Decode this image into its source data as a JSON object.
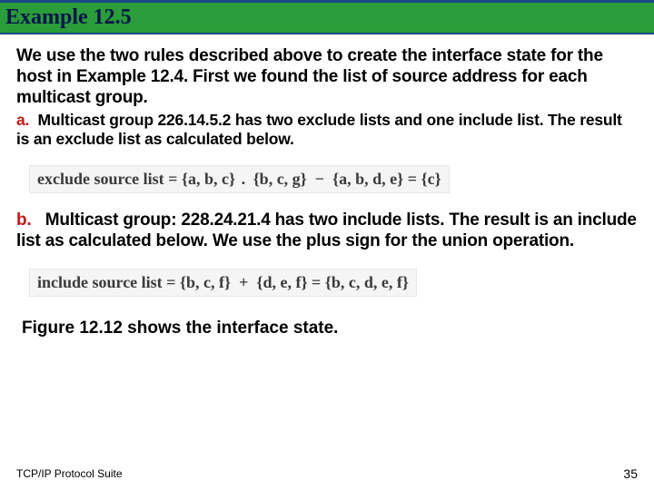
{
  "header": {
    "title": "Example 12.5"
  },
  "body": {
    "intro": "We use the two rules described above to create the interface state for the host in Example 12.4. First we found the list of source address for each multicast group.",
    "a_label": "a.",
    "a_text": "Multicast group 226.14.5.2 has two exclude lists and one include list. The result is an exclude list as calculated below.",
    "formula_a": "exclude source list = {a, b, c} . {b, c, g} − {a, b, d, e} = {c}",
    "b_label": "b.",
    "b_text": "Multicast group: 228.24.21.4 has two include lists. The result is an include list as calculated below. We use the plus sign for the union operation.",
    "formula_b": "include source list = {b, c, f} + {d, e, f} = {b, c, d, e, f}",
    "closing": "Figure 12.12 shows the interface state."
  },
  "footer": {
    "source": "TCP/IP Protocol Suite",
    "page": "35"
  }
}
